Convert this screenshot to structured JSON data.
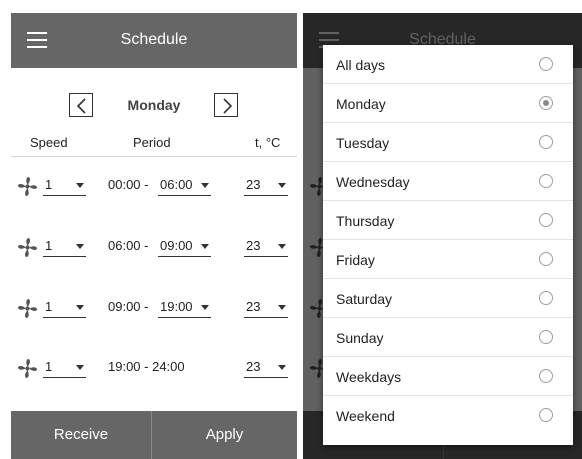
{
  "screen": {
    "title": "Schedule",
    "day": "Monday",
    "columns": {
      "speed": "Speed",
      "period": "Period",
      "temp": "t, °C"
    },
    "rows": [
      {
        "speed": "1",
        "start": "00:00 -",
        "end": "06:00",
        "temp": "23"
      },
      {
        "speed": "1",
        "start": "06:00 -",
        "end": "09:00",
        "temp": "23"
      },
      {
        "speed": "1",
        "start": "09:00 -",
        "end": "19:00",
        "temp": "23"
      },
      {
        "speed": "1",
        "period": "19:00 - 24:00",
        "temp": "23"
      }
    ],
    "buttons": {
      "receive": "Receive",
      "apply": "Apply"
    }
  },
  "dialog": {
    "selected": "Monday",
    "options": [
      "All days",
      "Monday",
      "Tuesday",
      "Wednesday",
      "Thursday",
      "Friday",
      "Saturday",
      "Sunday",
      "Weekdays",
      "Weekend"
    ]
  },
  "colors": {
    "appbar": "#666666",
    "scrim": "rgba(0,0,0,0.62)",
    "radio_checked": "#8a8a8a"
  },
  "icons": [
    "menu-icon",
    "chevron-left-icon",
    "chevron-right-icon",
    "fan-icon",
    "dropdown-caret-icon",
    "radio-icon"
  ]
}
